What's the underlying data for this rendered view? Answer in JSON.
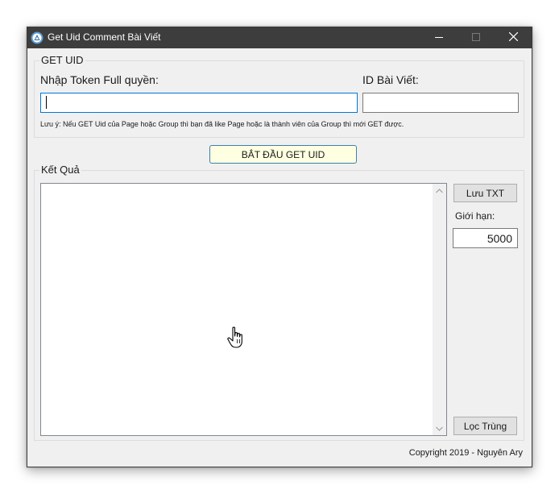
{
  "window": {
    "title": "Get Uid Comment Bài Viết",
    "app_icon": "triangle-logo-icon",
    "controls": {
      "minimize_icon": "minimize-icon",
      "maximize_icon": "maximize-icon",
      "close_icon": "close-icon"
    }
  },
  "get_uid_group": {
    "legend": "GET UID",
    "token_label": "Nhập Token Full quyền:",
    "token_value": "",
    "post_id_label": "ID Bài Viết:",
    "post_id_value": "",
    "note": "Lưu ý: Nếu GET Uid của Page hoặc Group thì bạn đã like Page hoặc là thành viên của Group thì mới GET được."
  },
  "start_button": {
    "label": "BẮT ĐẦU GET UID"
  },
  "result_group": {
    "legend": "Kết Quả",
    "output_text": "",
    "save_button": "Lưu TXT",
    "limit_label": "Giới hạn:",
    "limit_value": "5000",
    "dedupe_button": "Lọc Trùng"
  },
  "footer": {
    "copyright": "Copyright 2019 - Nguyên Ary"
  },
  "colors": {
    "titlebar": "#3d3d3d",
    "window_bg": "#f0f0f0",
    "focus_border": "#0078d7",
    "start_button_bg": "#ffffe1"
  }
}
